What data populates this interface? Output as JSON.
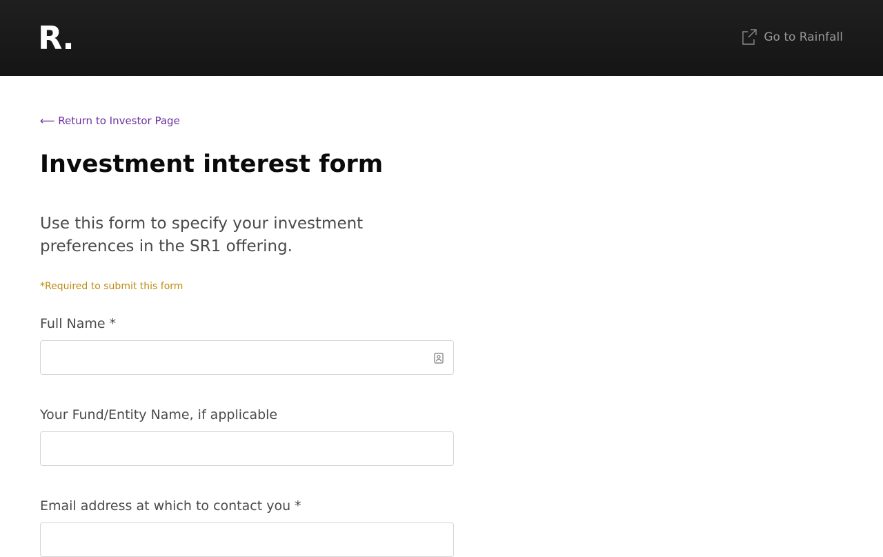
{
  "header": {
    "logo": "R.",
    "goto_link": "Go to Rainfall",
    "goto_icon": "external-link-icon"
  },
  "page": {
    "back_link": "⟵ Return to Investor Page",
    "title": "Investment interest form",
    "intro": "Use this form to specify your investment preferences in the SR1 offering.",
    "required_note": "*Required to submit this form"
  },
  "fields": [
    {
      "label": "Full Name *",
      "value": "",
      "placeholder": ""
    },
    {
      "label": "Your Fund/Entity Name, if applicable",
      "value": "",
      "placeholder": ""
    },
    {
      "label": "Email address at which to contact you *",
      "value": "",
      "placeholder": ""
    }
  ],
  "colors": {
    "header_bg": "#1a1a1a",
    "link": "#6b2fa0",
    "required_note": "#c08a10",
    "body_text": "#4a4a4a"
  }
}
